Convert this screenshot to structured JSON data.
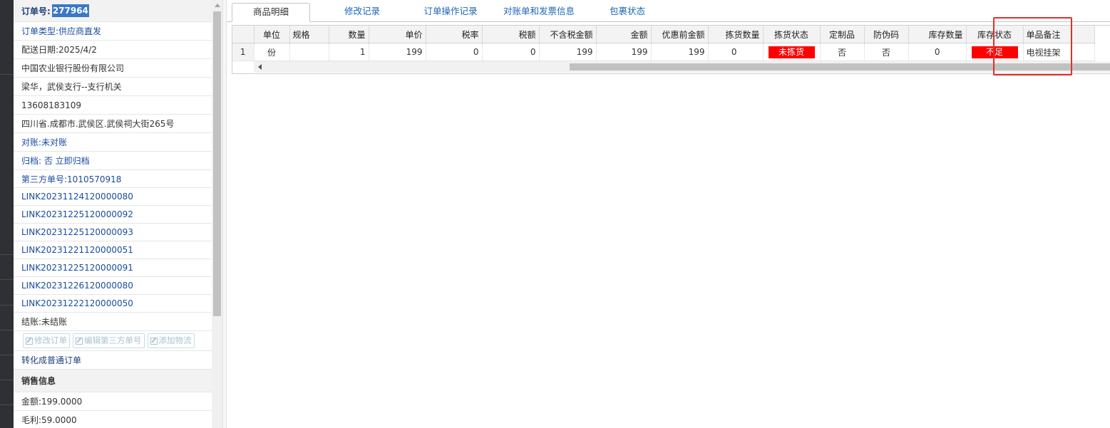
{
  "order": {
    "number_label": "订单号:",
    "number": "277964",
    "type": "订单类型:供应商直发",
    "delivery_date": "配送日期:2025/4/2",
    "customer": "中国农业银行股份有限公司",
    "contact": "梁华，武侯支行--支行机关",
    "phone": "13608183109",
    "address": "四川省.成都市.武侯区.武侯祠大街265号",
    "reconcile": "对账:未对账",
    "archive": "归档: 否 立即归档",
    "third_party": "第三方单号:1010570918",
    "links": [
      "LINK20231124120000080",
      "LINK20231225120000092",
      "LINK20231225120000093",
      "LINK20231221120000051",
      "LINK20231225120000091",
      "LINK20231226120000080",
      "LINK20231222120000050"
    ],
    "settlement": "结账:未结账",
    "buttons": {
      "edit_order": "修改订单",
      "edit_third_party": "编辑第三方单号",
      "add_logistics": "添加物流"
    },
    "convert": "转化成普通订单"
  },
  "sales": {
    "title": "销售信息",
    "amount": "金额:199.0000",
    "profit": "毛利:59.0000"
  },
  "tabs": [
    "商品明细",
    "修改记录",
    "订单操作记录",
    "对账单和发票信息",
    "包裹状态"
  ],
  "grid": {
    "headers": [
      "单位",
      "规格",
      "数量",
      "单价",
      "税率",
      "税额",
      "不含税金额",
      "金额",
      "优惠前金额",
      "拣货数量",
      "拣货状态",
      "定制品",
      "防伪码",
      "库存数量",
      "库存状态",
      "单品备注"
    ],
    "row": {
      "row_no": "1",
      "unit": "份",
      "spec": "",
      "qty": "1",
      "unit_price": "199",
      "tax_rate": "0",
      "tax_amount": "0",
      "amount_ex_tax": "199",
      "amount": "199",
      "amount_before_discount": "199",
      "pick_qty": "0",
      "pick_status": "未拣货",
      "custom": "否",
      "anti_fake": "否",
      "stock_qty": "0",
      "stock_status": "不足",
      "remark": "电视挂架"
    }
  },
  "colors": {
    "link_blue": "#1a4ca0",
    "highlight": "#3b78c9",
    "alert_red": "#ff0000",
    "annotation_red": "#e0302a"
  }
}
